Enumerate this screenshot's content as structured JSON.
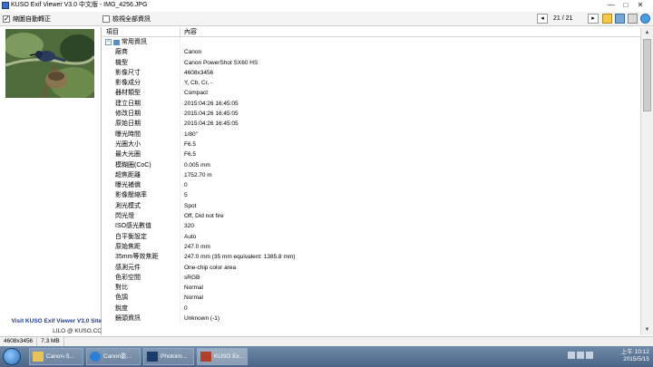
{
  "window": {
    "title": "KUSO Exif Viewer V3.0 中文版 - IMG_4256.JPG",
    "min": "—",
    "max": "□",
    "close": "✕"
  },
  "toolbar": {
    "auto_rotate": "縮圖自動轉正",
    "auto_rotate_checked": true,
    "show_all": "檢視全部資訊",
    "show_all_checked": false,
    "prev": "◂",
    "next": "▸",
    "counter": "21 / 21"
  },
  "sidebar": {
    "site": "Visit KUSO Exif Viewer V3.0 Site",
    "credit": "LILO @ KUSO.CC"
  },
  "table": {
    "headers": [
      "項目",
      "內容"
    ],
    "group": {
      "expander": "−",
      "label": "常用資訊"
    },
    "rows": [
      {
        "k": "廠商",
        "v": "Canon"
      },
      {
        "k": "機型",
        "v": "Canon PowerShot SX60 HS"
      },
      {
        "k": "影像尺寸",
        "v": "4608x3456"
      },
      {
        "k": "影像成分",
        "v": "Y, Cb, Cr, -"
      },
      {
        "k": "器材類型",
        "v": "Compact"
      },
      {
        "k": "建立日期",
        "v": "2015:04:26 16:45:05"
      },
      {
        "k": "修改日期",
        "v": "2015:04:26 16:45:05"
      },
      {
        "k": "原始日期",
        "v": "2015:04:26 16:45:05"
      },
      {
        "k": "曝光時間",
        "v": "1/80\""
      },
      {
        "k": "光圈大小",
        "v": "F6.5"
      },
      {
        "k": "最大光圈",
        "v": "F6.5"
      },
      {
        "k": "模糊圈(CoC)",
        "v": "0.005 mm"
      },
      {
        "k": "超焦距離",
        "v": "1752.70 m"
      },
      {
        "k": "曝光補償",
        "v": "0"
      },
      {
        "k": "影像壓縮率",
        "v": "5"
      },
      {
        "k": "測光模式",
        "v": "Spot"
      },
      {
        "k": "閃光燈",
        "v": "Off, Did not fire"
      },
      {
        "k": "ISO感光數值",
        "v": "320"
      },
      {
        "k": "白平衡設定",
        "v": "Auto"
      },
      {
        "k": "原始焦距",
        "v": "247.0 mm"
      },
      {
        "k": "35mm等效焦距",
        "v": "247.0 mm (35 mm equivalent: 1385.8 mm)"
      },
      {
        "k": "感測元件",
        "v": "One-chip color area"
      },
      {
        "k": "色彩空間",
        "v": "sRGB"
      },
      {
        "k": "對比",
        "v": "Normal"
      },
      {
        "k": "色調",
        "v": "Normal"
      },
      {
        "k": "銳度",
        "v": "0"
      },
      {
        "k": "鏡頭資訊",
        "v": "Unknown (-1)"
      }
    ]
  },
  "statusbar": {
    "dimensions": "4608x3456",
    "filesize": "7.3 MB"
  },
  "taskbar": {
    "tasks": [
      "Canon-S...",
      "Canon影...",
      "Photoim...",
      "KUSO Ex..."
    ],
    "clock_time": "上午 10:12",
    "clock_date": "2015/5/15"
  }
}
